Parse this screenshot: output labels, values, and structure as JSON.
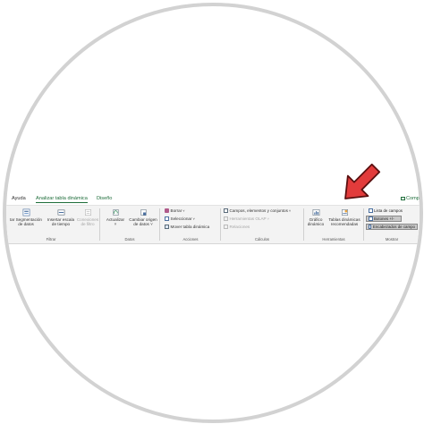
{
  "tabs": [
    {
      "label": "Ayuda"
    },
    {
      "label": "Analizar tabla dinámica"
    },
    {
      "label": "Diseño"
    }
  ],
  "tab_right": "Comp",
  "groups": {
    "filtrar": {
      "label": "Filtrar",
      "buttons": [
        {
          "line1": "tar Segmentación",
          "line2": "de datos"
        },
        {
          "line1": "Insertar escala",
          "line2": "de tiempo"
        },
        {
          "line1": "Conexiones",
          "line2": "de filtro"
        }
      ]
    },
    "datos": {
      "label": "Datos",
      "buttons": [
        {
          "line1": "Actualizar",
          "line2": "˅"
        },
        {
          "line1": "Cambiar origen",
          "line2": "de datos ˅"
        }
      ]
    },
    "acciones": {
      "label": "Acciones",
      "items": [
        {
          "label": "Borrar",
          "caret": "˅"
        },
        {
          "label": "Seleccionar",
          "caret": "˅"
        },
        {
          "label": "Mover tabla dinámica",
          "caret": ""
        }
      ]
    },
    "calculos": {
      "label": "Cálculos",
      "items": [
        {
          "label": "Campos, elementos y conjuntos",
          "caret": "˅"
        },
        {
          "label": "Herramientas OLAP",
          "caret": "˅"
        },
        {
          "label": "Relaciones",
          "caret": ""
        }
      ]
    },
    "herramientas": {
      "label": "Herramientas",
      "buttons": [
        {
          "line1": "Gráfico",
          "line2": "dinámico"
        },
        {
          "line1": "Tablas dinámicas",
          "line2": "recomendadas"
        }
      ]
    },
    "mostrar": {
      "label": "Mostrar",
      "items": [
        {
          "label": "Lista de campos"
        },
        {
          "label": "Botones +/-"
        },
        {
          "label": "Encabezados de campo"
        }
      ]
    }
  },
  "colors": {
    "accent": "#1e6d3a",
    "arrow": "#e23b3b",
    "ribbon_bg": "#f3f3f3"
  }
}
